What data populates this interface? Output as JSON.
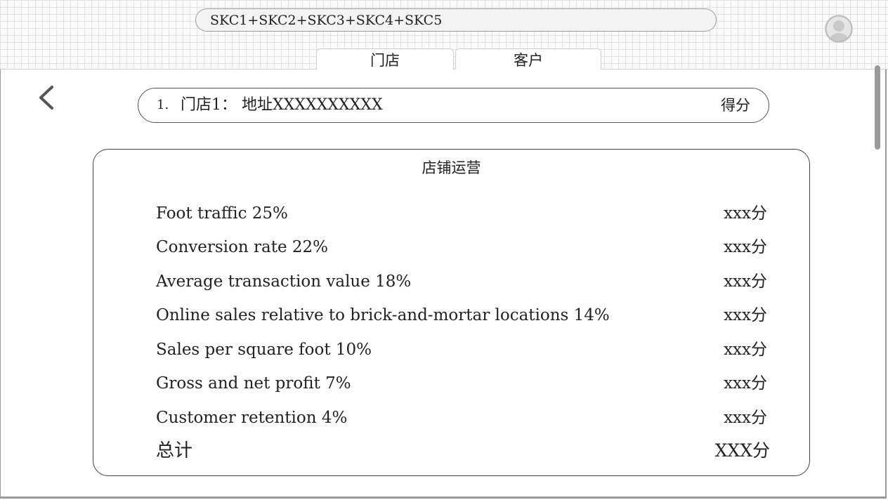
{
  "search": {
    "value": "SKC1+SKC2+SKC3+SKC4+SKC5"
  },
  "avatar": {
    "icon": "user-avatar-icon"
  },
  "tabs": [
    {
      "label": "门店"
    },
    {
      "label": "客户"
    }
  ],
  "back": {
    "icon": "chevron-left-icon"
  },
  "store": {
    "index": "1.",
    "name": "门店1：  地址XXXXXXXXXX",
    "score_label": "得分"
  },
  "card": {
    "title": "店铺运营",
    "metrics": [
      {
        "label": "Foot traffic 25%",
        "value": "xxx分"
      },
      {
        "label": "Conversion rate 22%",
        "value": "xxx分"
      },
      {
        "label": "Average transaction value 18%",
        "value": "xxx分"
      },
      {
        "label": "Online sales relative to brick-and-mortar locations 14%",
        "value": "xxx分"
      },
      {
        "label": "Sales per square foot 10%",
        "value": "xxx分"
      },
      {
        "label": "Gross and net profit 7%",
        "value": "xxx分"
      },
      {
        "label": "Customer retention 4%",
        "value": "xxx分"
      }
    ],
    "total": {
      "label": "总计",
      "value": "XXX分"
    }
  },
  "colors": {
    "border": "#444444",
    "grid": "#e2e2e2",
    "scrollbar": "#9a9a9a"
  }
}
